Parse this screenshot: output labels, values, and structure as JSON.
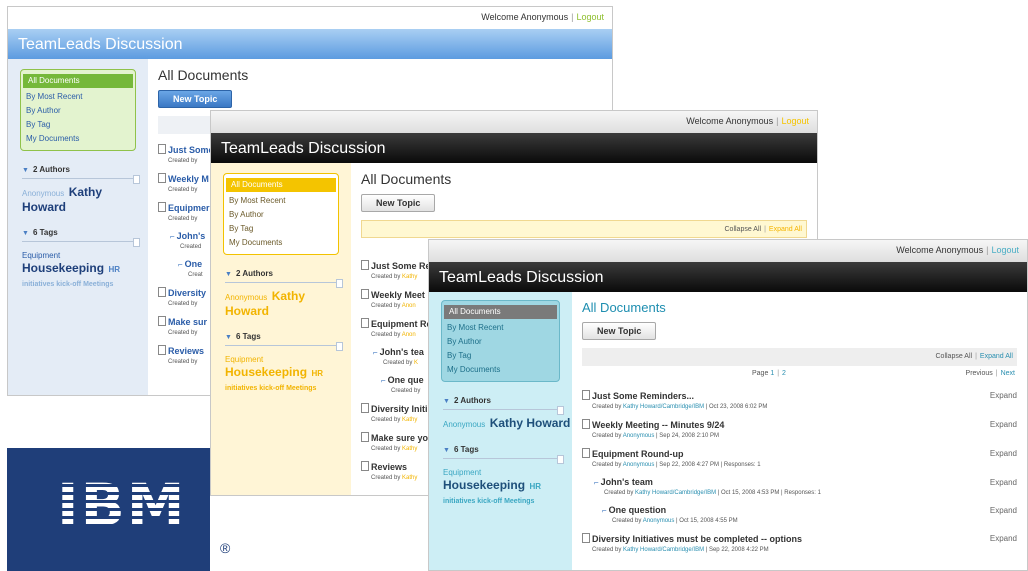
{
  "topbar": {
    "welcome": "Welcome Anonymous",
    "sep": "|",
    "logout": "Logout"
  },
  "app_title": "TeamLeads Discussion",
  "nav": [
    "All Documents",
    "By Most Recent",
    "By Author",
    "By Tag",
    "My Documents"
  ],
  "authors": {
    "header": "2 Authors",
    "first": "Anonymous",
    "second": "Kathy Howard"
  },
  "tags": {
    "header": "6 Tags",
    "t1": "Equipment",
    "t2": "Housekeeping",
    "t3": "HR",
    "t4": "initiatives kick-off Meetings"
  },
  "main": {
    "title": "All Documents",
    "new_topic": "New Topic",
    "collapse_all": "Collapse All",
    "expand_all": "Expand All",
    "page_label": "Page",
    "page1": "1",
    "page2": "2",
    "previous": "Previous",
    "next": "Next",
    "expand": "Expand"
  },
  "topics_short": [
    {
      "title": "Just Some",
      "meta": "Created by"
    },
    {
      "title": "Weekly M",
      "meta": "Created by"
    },
    {
      "title": "Equipmer",
      "meta": "Created by"
    },
    {
      "title": "John's",
      "meta": "Created"
    },
    {
      "title": "One",
      "meta": "Creat"
    },
    {
      "title": "Diversity",
      "meta": "Created by"
    },
    {
      "title": "Make sur",
      "meta": "Created by"
    },
    {
      "title": "Reviews",
      "meta": "Created by"
    }
  ],
  "topics_mid": [
    {
      "title": "Just Some Re",
      "meta": "Created by",
      "by": "Kathy"
    },
    {
      "title": "Weekly Meet",
      "meta": "Created by",
      "by": "Anon"
    },
    {
      "title": "Equipment Re",
      "meta": "Created by",
      "by": "Anon"
    },
    {
      "title": "John's tea",
      "meta": "Created by",
      "by": "K"
    },
    {
      "title": "One que",
      "meta": "Created by",
      "by": ""
    },
    {
      "title": "Diversity Initi",
      "meta": "Created by",
      "by": "Kathy"
    },
    {
      "title": "Make sure yo",
      "meta": "Created by",
      "by": "Kathy"
    },
    {
      "title": "Reviews",
      "meta": "Created by",
      "by": "Kathy"
    }
  ],
  "topics_full": [
    {
      "title": "Just Some Reminders...",
      "by": "Kathy Howard/Cambridge/IBM",
      "rest": " | Oct 23, 2008 6:02 PM"
    },
    {
      "title": "Weekly Meeting -- Minutes 9/24",
      "by": "Anonymous",
      "rest": " | Sep 24, 2008 2:10 PM"
    },
    {
      "title": "Equipment Round-up",
      "by": "Anonymous",
      "rest": " | Sep 22, 2008 4:27 PM | Responses: 1"
    },
    {
      "title": "John's team",
      "by": "Kathy Howard/Cambridge/IBM",
      "rest": " | Oct 15, 2008 4:53 PM | Responses: 1"
    },
    {
      "title": "One question",
      "by": "Anonymous",
      "rest": " | Oct 15, 2008 4:55 PM"
    },
    {
      "title": "Diversity Initiatives must be completed -- options",
      "by": "Kathy Howard/Cambridge/IBM",
      "rest": " | Sep 22, 2008 4:22 PM"
    }
  ],
  "created_by": "Created by",
  "ibm": {
    "logo": "IBM",
    "reg": "®"
  },
  "colors": {
    "win1_accent": "#75b83a",
    "win2_accent": "#f4c400",
    "win3_accent": "#4aaec5",
    "ibm_blue": "#1f3e79"
  }
}
